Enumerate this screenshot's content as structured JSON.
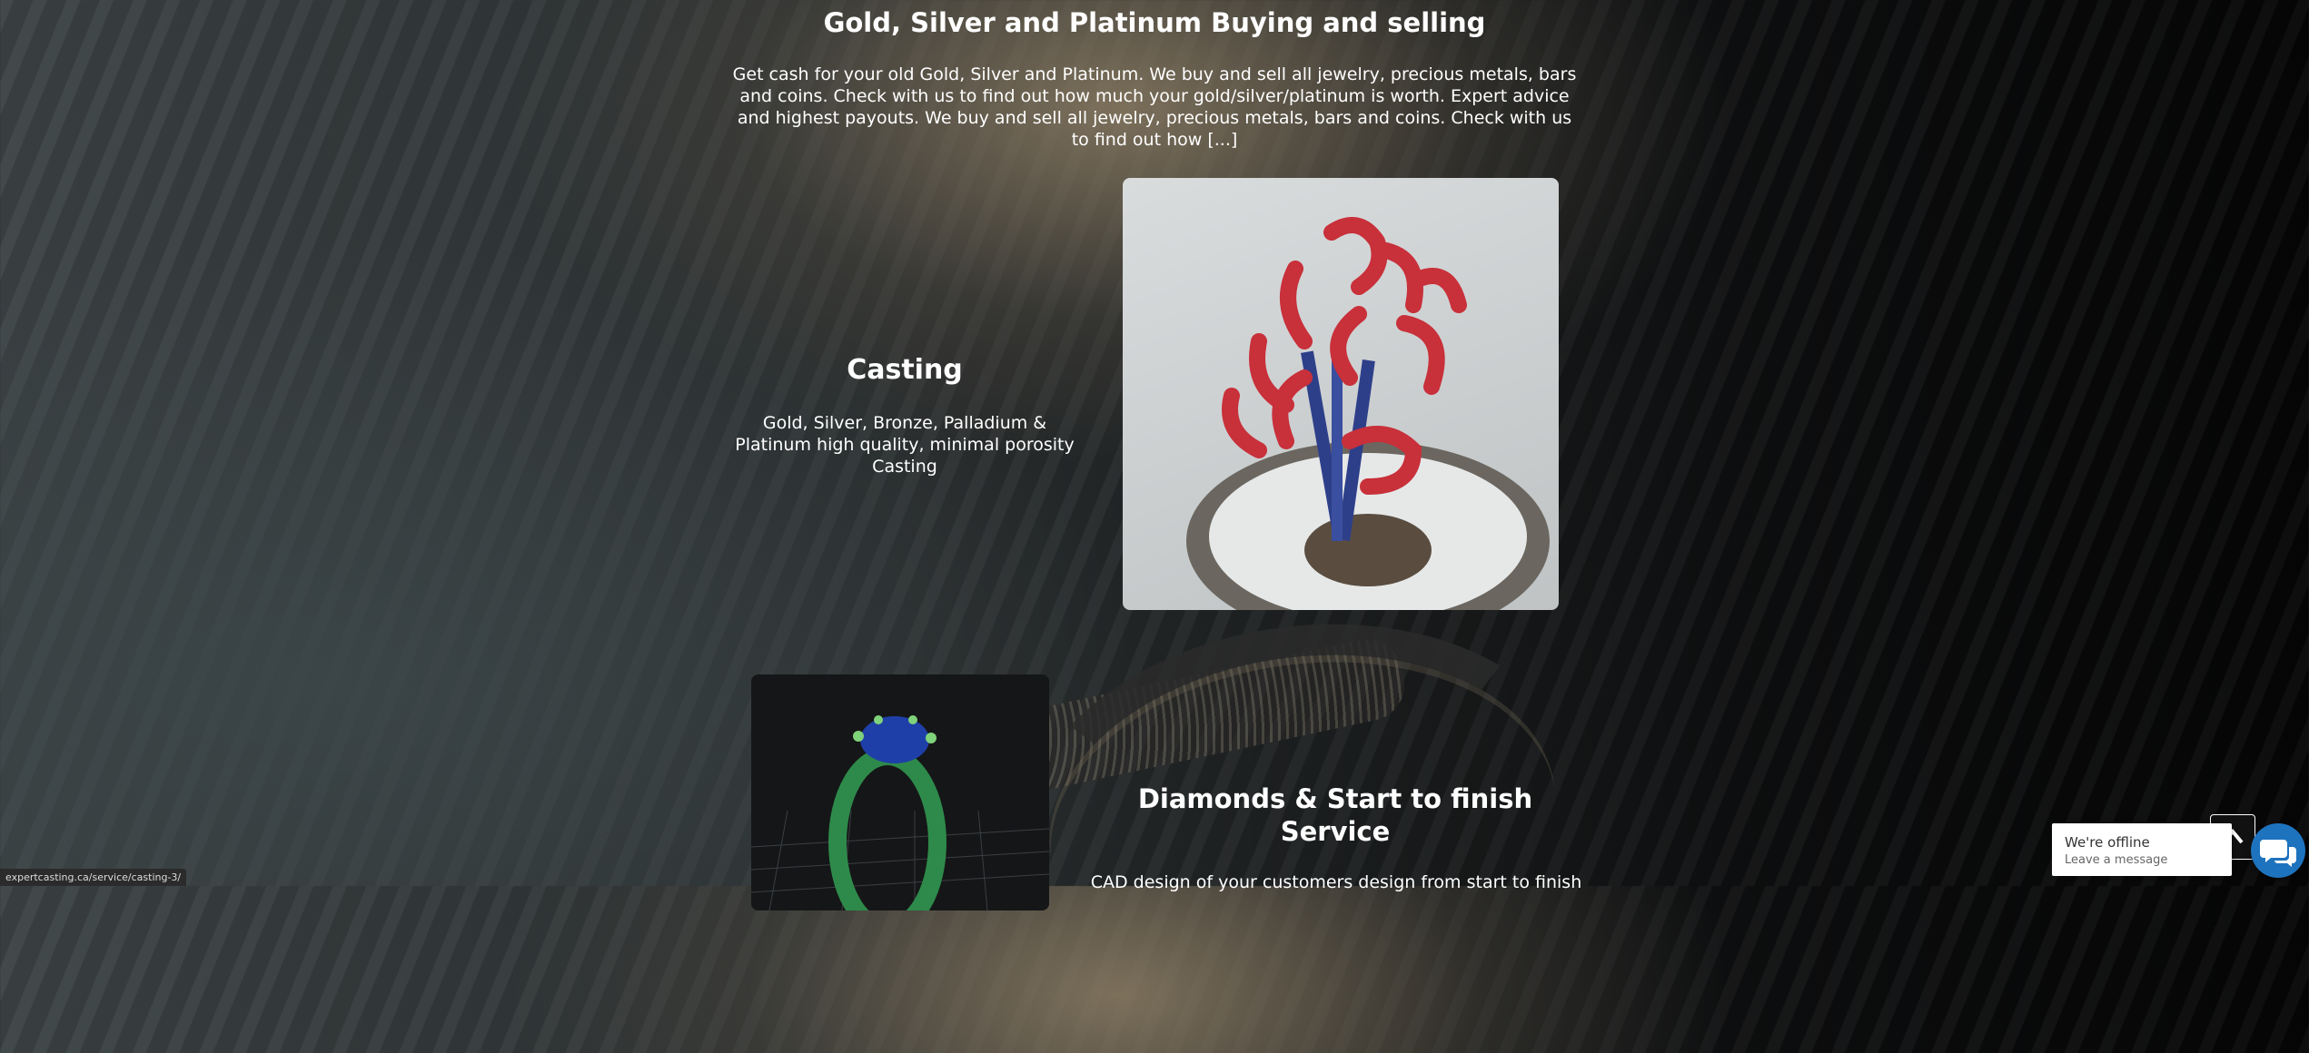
{
  "buying": {
    "title": "Gold, Silver and Platinum Buying and selling",
    "description": "Get cash for your old Gold, Silver and Platinum. We buy and sell all jewelry, precious metals, bars and coins. Check with us to find out how much your gold/silver/platinum is worth. Expert advice and highest payouts. We buy and sell all jewelry, precious metals, bars and coins. Check with us to find out how [...]"
  },
  "casting": {
    "title": "Casting",
    "description": "Gold, Silver, Bronze, Palladium & Platinum high quality, minimal porosity Casting",
    "image_icon": "casting-tree-image"
  },
  "diamonds": {
    "title": "Diamonds & Start to finish Service",
    "description": "CAD design of your customers design from start to finish",
    "image_icon": "cad-ring-image"
  },
  "status_bar": {
    "url": "expertcasting.ca/service/casting-3/"
  },
  "chat": {
    "status": "We're offline",
    "prompt": "Leave a message",
    "icon": "chat-bubbles-icon",
    "accent": "#1e73be"
  },
  "scroll_top": {
    "icon": "arrow-up-icon"
  }
}
